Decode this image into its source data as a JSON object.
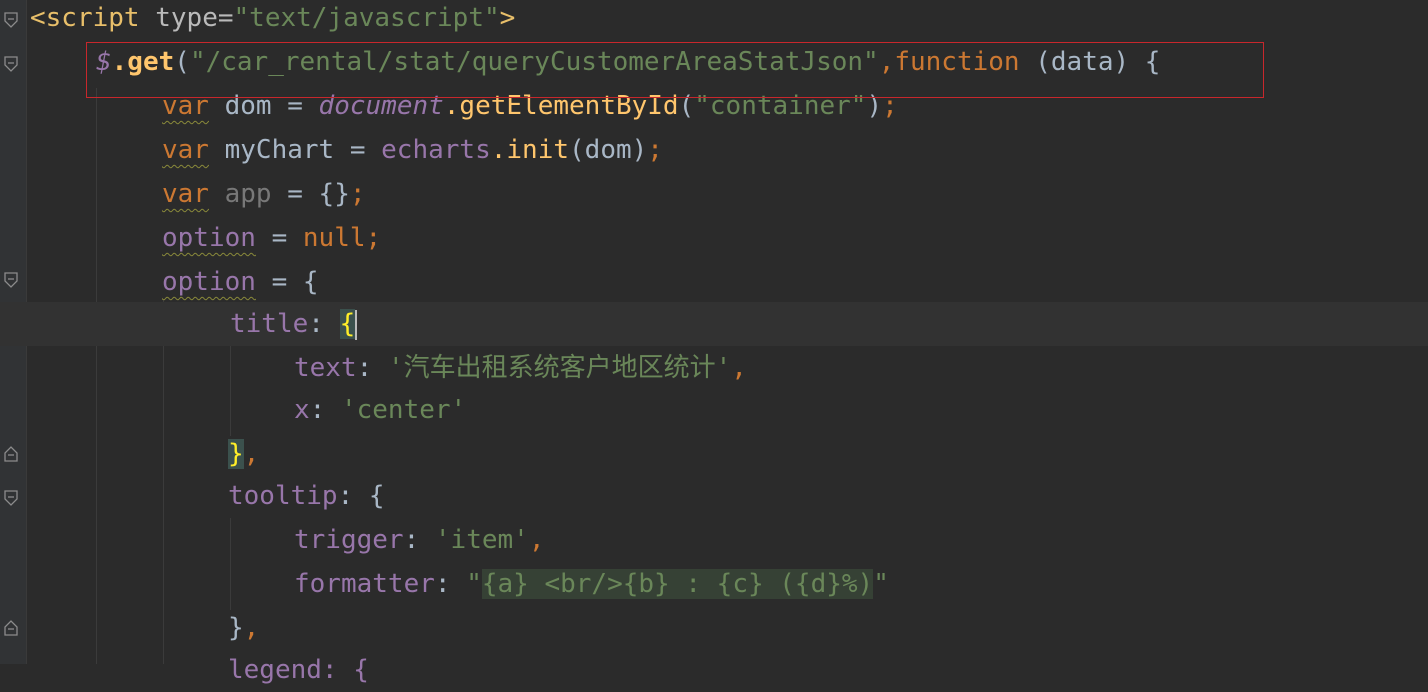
{
  "editor": {
    "language": "javascript",
    "highlight_box_color": "#c8272c",
    "lines": [
      {
        "tag_open": "<script",
        "type_attr": "type=",
        "type_value": "\"text/javascript\"",
        "tag_close": ">"
      },
      {
        "dollar": "$",
        "get": ".get",
        "paren": "(",
        "url": "\"/car_rental/stat/queryCustomerAreaStatJson\"",
        "comma": ",",
        "function_kw": "function",
        "params": " (data) {"
      },
      {
        "var_kw": "var",
        "name": " dom = ",
        "document": "document",
        "call": ".getElementById",
        "open": "(",
        "arg": "\"container\"",
        "close": ")",
        "semi": ";"
      },
      {
        "var_kw": "var",
        "name": " myChart = ",
        "echarts": "echarts",
        "init": ".init",
        "args": "(dom)",
        "semi": ";"
      },
      {
        "var_kw": "var",
        "name": " app",
        "rest": " = {}",
        "semi": ";"
      },
      {
        "option": "option",
        "eq": " = ",
        "null_kw": "null",
        "semi": ";"
      },
      {
        "option": "option",
        "rest": " = {"
      },
      {
        "key": "title",
        "colon": ": ",
        "brace": "{"
      },
      {
        "key": "text",
        "colon": ": ",
        "value": "'汽车出租系统客户地区统计'",
        "comma": ","
      },
      {
        "key": "x",
        "colon": ": ",
        "value": "'center'"
      },
      {
        "brace": "}",
        "comma": ","
      },
      {
        "key": "tooltip",
        "colon": ": ",
        "brace": "{"
      },
      {
        "key": "trigger",
        "colon": ": ",
        "value": "'item'",
        "comma": ","
      },
      {
        "key": "formatter",
        "colon": ": ",
        "quote_open": "\"",
        "template": "{a} <br/>{b} : {c} ({d}%)",
        "quote_close": "\""
      },
      {
        "brace": "}",
        "comma": ","
      },
      {
        "partial": "legend: {"
      }
    ]
  }
}
